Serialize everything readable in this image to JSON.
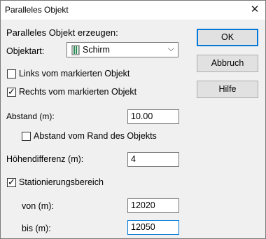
{
  "window": {
    "title": "Paralleles Objekt",
    "close_glyph": "✕"
  },
  "header": {
    "label": "Paralleles Objekt erzeugen:"
  },
  "objektart": {
    "label": "Objektart:",
    "value": "Schirm",
    "icon": "schirm-icon",
    "chevron": "⌵"
  },
  "checkboxes": {
    "links": {
      "label": "Links vom markierten Objekt",
      "checked": false
    },
    "rechts": {
      "label": "Rechts vom markierten Objekt",
      "checked": true
    },
    "rand": {
      "label": "Abstand vom Rand des Objekts",
      "checked": false
    },
    "station": {
      "label": "Stationierungsbereich",
      "checked": true
    }
  },
  "abstand": {
    "label": "Abstand (m):",
    "value": "10.00"
  },
  "hoehe": {
    "label": "Höhendifferenz (m):",
    "value": "4"
  },
  "von": {
    "label": "von (m):",
    "value": "12020"
  },
  "bis": {
    "label": "bis (m):",
    "value": "12050"
  },
  "buttons": {
    "ok": "OK",
    "abbruch": "Abbruch",
    "hilfe": "Hilfe"
  },
  "check_glyph": "✓",
  "colors": {
    "focus": "#0078d7",
    "icon_green": "#2e8b57"
  }
}
